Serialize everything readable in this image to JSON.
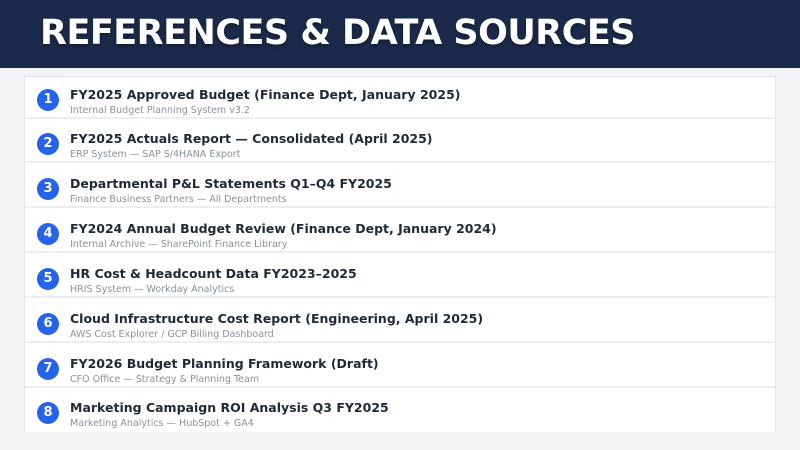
{
  "header": {
    "title": "REFERENCES & DATA SOURCES",
    "background_color": "#1b2a4a"
  },
  "accent_color": "#2563eb",
  "references": [
    {
      "number": "1",
      "title": "FY2025 Approved Budget (Finance Dept, January 2025)",
      "subtitle": "Internal Budget Planning System v3.2"
    },
    {
      "number": "2",
      "title": "FY2025 Actuals Report — Consolidated (April 2025)",
      "subtitle": "ERP System — SAP S/4HANA Export"
    },
    {
      "number": "3",
      "title": "Departmental P&L Statements Q1–Q4 FY2025",
      "subtitle": "Finance Business Partners — All Departments"
    },
    {
      "number": "4",
      "title": "FY2024 Annual Budget Review (Finance Dept, January 2024)",
      "subtitle": "Internal Archive — SharePoint Finance Library"
    },
    {
      "number": "5",
      "title": "HR Cost & Headcount Data FY2023–2025",
      "subtitle": "HRIS System — Workday Analytics"
    },
    {
      "number": "6",
      "title": "Cloud Infrastructure Cost Report (Engineering, April 2025)",
      "subtitle": "AWS Cost Explorer / GCP Billing Dashboard"
    },
    {
      "number": "7",
      "title": "FY2026 Budget Planning Framework (Draft)",
      "subtitle": "CFO Office — Strategy & Planning Team"
    },
    {
      "number": "8",
      "title": "Marketing Campaign ROI Analysis Q3 FY2025",
      "subtitle": "Marketing Analytics — HubSpot + GA4"
    }
  ]
}
